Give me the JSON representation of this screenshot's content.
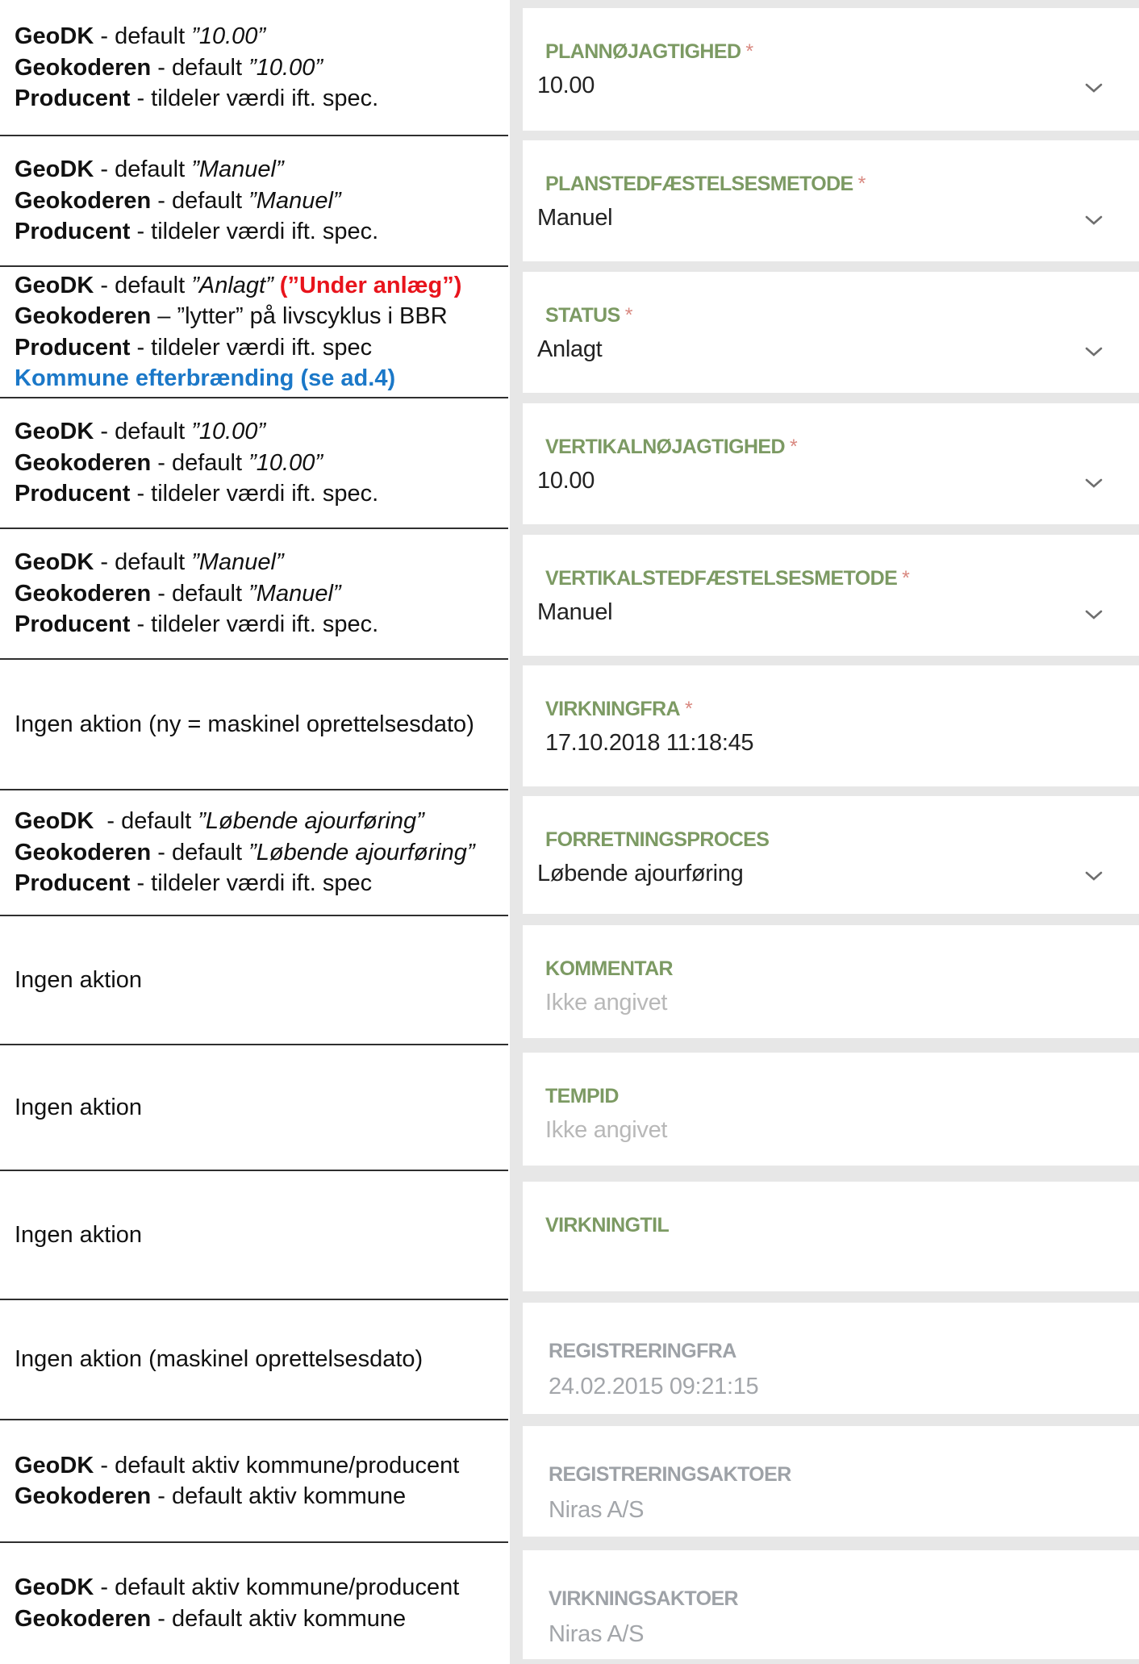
{
  "rows": [
    {
      "notes": [
        {
          "b": "GeoDK",
          "t": " - default ",
          "i": "”10.00”"
        },
        {
          "b": "Geokoderen",
          "t": " - default ",
          "i": "”10.00”"
        },
        {
          "b": "Producent",
          "t": " - tildeler værdi ift. spec."
        }
      ],
      "field": {
        "label": "PLANNØJAGTIGHED",
        "required": "*",
        "value": "10.00",
        "has_dropdown": true,
        "state": "editable"
      }
    },
    {
      "notes": [
        {
          "b": "GeoDK",
          "t": " - default ",
          "i": "”Manuel”"
        },
        {
          "b": "Geokoderen",
          "t": " - default ",
          "i": "”Manuel”"
        },
        {
          "b": "Producent",
          "t": " - tildeler værdi ift. spec."
        }
      ],
      "field": {
        "label": "PLANSTEDFÆSTELSESMETODE",
        "required": "*",
        "value": "Manuel",
        "has_dropdown": true,
        "state": "editable"
      }
    },
    {
      "notes": [
        {
          "b": "GeoDK",
          "t": " - default ",
          "i": "”Anlagt”",
          "red": " (”Under anlæg”)"
        },
        {
          "b": "Geokoderen",
          "t": " – ”lytter” på livscyklus i BBR"
        },
        {
          "b": "Producent",
          "t": " - tildeler værdi ift. spec"
        },
        {
          "blue": "Kommune efterbrænding (se ad.4)"
        }
      ],
      "field": {
        "label": "STATUS",
        "required": "*",
        "value": "Anlagt",
        "has_dropdown": true,
        "state": "editable"
      }
    },
    {
      "notes": [
        {
          "b": "GeoDK",
          "t": " - default ",
          "i": "”10.00”"
        },
        {
          "b": "Geokoderen",
          "t": " - default ",
          "i": "”10.00”"
        },
        {
          "b": "Producent",
          "t": " - tildeler værdi ift. spec."
        }
      ],
      "field": {
        "label": "VERTIKALNØJAGTIGHED",
        "required": "*",
        "value": "10.00",
        "has_dropdown": true,
        "state": "editable"
      }
    },
    {
      "notes": [
        {
          "b": "GeoDK",
          "t": " - default ",
          "i": "”Manuel”"
        },
        {
          "b": "Geokoderen",
          "t": " - default ",
          "i": "”Manuel”"
        },
        {
          "b": "Producent",
          "t": " - tildeler værdi ift. spec."
        }
      ],
      "field": {
        "label": "VERTIKALSTEDFÆSTELSESMETODE",
        "required": "*",
        "value": "Manuel",
        "has_dropdown": true,
        "state": "editable"
      }
    },
    {
      "notes": [
        {
          "t": "Ingen aktion (ny = maskinel oprettelsesdato)"
        }
      ],
      "field": {
        "label": "VIRKNINGFRA",
        "required": "*",
        "value": "17.10.2018 11:18:45",
        "has_dropdown": false,
        "state": "editable"
      }
    },
    {
      "notes": [
        {
          "b": "GeoDK",
          "t": "  - default ",
          "i": "”Løbende ajourføring”"
        },
        {
          "b": "Geokoderen",
          "t": " - default ",
          "i": "”Løbende ajourføring”"
        },
        {
          "b": "Producent",
          "t": " - tildeler værdi ift. spec"
        }
      ],
      "field": {
        "label": "FORRETNINGSPROCES",
        "required": "",
        "value": "Løbende ajourføring",
        "has_dropdown": true,
        "state": "editable"
      }
    },
    {
      "notes": [
        {
          "t": "Ingen aktion"
        }
      ],
      "field": {
        "label": "KOMMENTAR",
        "required": "",
        "value": "Ikke angivet",
        "has_dropdown": false,
        "state": "placeholder"
      }
    },
    {
      "notes": [
        {
          "t": "Ingen aktion"
        }
      ],
      "field": {
        "label": "TEMPID",
        "required": "",
        "value": "Ikke angivet",
        "has_dropdown": false,
        "state": "placeholder"
      }
    },
    {
      "notes": [
        {
          "t": "Ingen aktion"
        }
      ],
      "field": {
        "label": "VIRKNINGTIL",
        "required": "",
        "value": "",
        "has_dropdown": false,
        "state": "editable"
      }
    },
    {
      "notes": [
        {
          "t": "Ingen aktion (maskinel oprettelsesdato)"
        }
      ],
      "field": {
        "label": "REGISTRERINGFRA",
        "required": "",
        "value": "24.02.2015 09:21:15",
        "has_dropdown": false,
        "state": "readonly"
      }
    },
    {
      "notes": [
        {
          "b": "GeoDK",
          "t": " - default aktiv kommune/producent"
        },
        {
          "b": "Geokoderen",
          "t": " - default aktiv kommune"
        }
      ],
      "field": {
        "label": "REGISTRERINGSAKTOER",
        "required": "",
        "value": "Niras A/S",
        "has_dropdown": false,
        "state": "readonly"
      }
    },
    {
      "notes": [
        {
          "b": "GeoDK",
          "t": " - default aktiv kommune/producent"
        },
        {
          "b": "Geokoderen",
          "t": " - default aktiv kommune"
        }
      ],
      "field": {
        "label": "VIRKNINGSAKTOER",
        "required": "",
        "value": "Niras A/S",
        "has_dropdown": false,
        "state": "readonly"
      }
    }
  ],
  "colors": {
    "label_active": "#7c9a63",
    "label_muted": "#9ea2a7",
    "required_star": "#d98981",
    "note_red": "#e8141c",
    "note_blue": "#1b78c8",
    "panel_bg": "#e7e7e7"
  }
}
